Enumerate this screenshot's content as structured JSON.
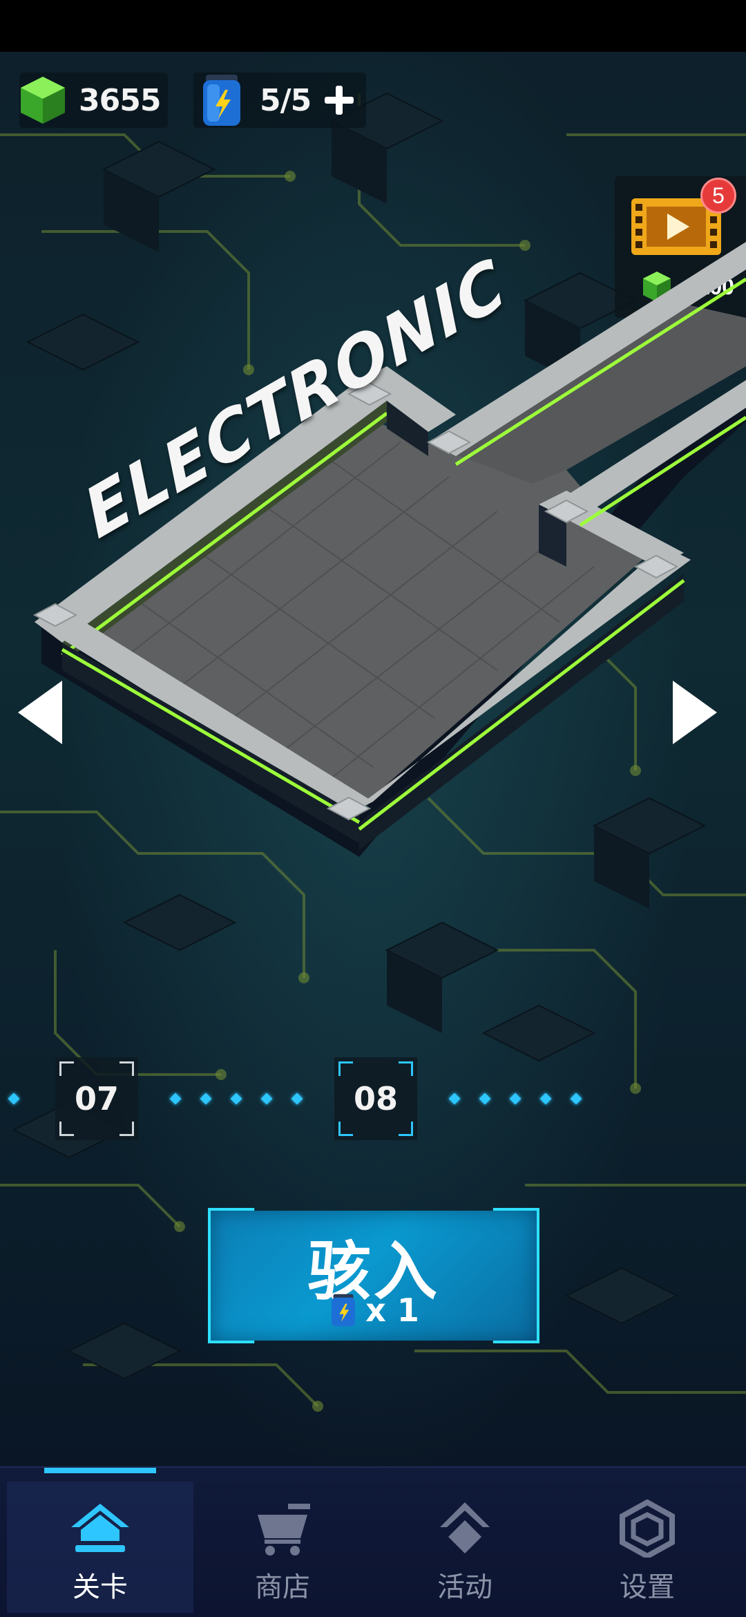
{
  "hud": {
    "gems": "3655",
    "energy": "5/5",
    "add_energy_icon": "plus-icon"
  },
  "video_reward": {
    "badge_count": "5",
    "reward_text": "+ 100",
    "icon": "film-play-icon"
  },
  "level": {
    "name": "ELECTRONIC"
  },
  "level_selector": {
    "nodes": [
      {
        "label": "07",
        "current": false
      },
      {
        "label": "08",
        "current": true
      }
    ]
  },
  "play_button": {
    "label": "骇入",
    "cost": "x 1"
  },
  "bottom_nav": {
    "items": [
      {
        "label": "关卡",
        "icon": "home-icon",
        "active": true
      },
      {
        "label": "商店",
        "icon": "cart-icon",
        "active": false
      },
      {
        "label": "活动",
        "icon": "event-icon",
        "active": false
      },
      {
        "label": "设置",
        "icon": "gear-icon",
        "active": false
      }
    ]
  },
  "colors": {
    "accent": "#2ec6ff",
    "neon_green": "#9dff3a",
    "play_button": "#0a99cf",
    "nav_bg": "#101a3a"
  }
}
